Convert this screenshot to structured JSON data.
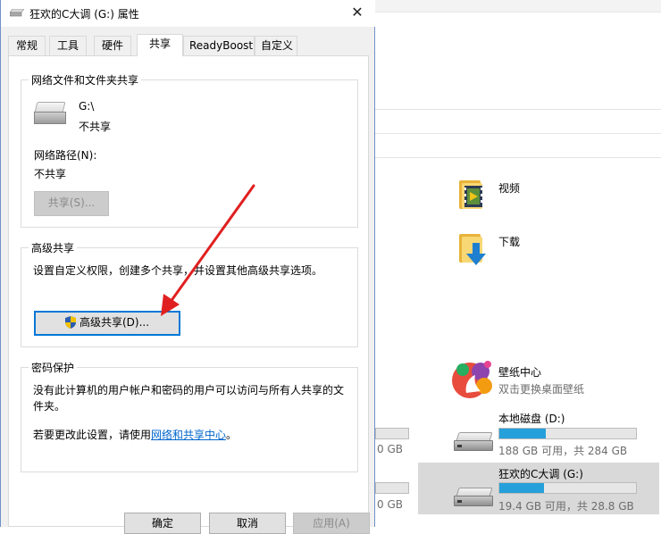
{
  "dialog": {
    "title": "狂欢的C大调 (G:) 属性",
    "close_icon": "close-icon",
    "tabs": [
      {
        "label": "常规"
      },
      {
        "label": "工具"
      },
      {
        "label": "硬件"
      },
      {
        "label": "共享",
        "active": true
      },
      {
        "label": "ReadyBoost"
      },
      {
        "label": "自定义"
      }
    ],
    "network_sharing": {
      "group_title": "网络文件和文件夹共享",
      "drive_name": "G:\\",
      "drive_status": "不共享",
      "network_path_label": "网络路径(N):",
      "network_path_value": "不共享",
      "share_button": "共享(S)..."
    },
    "advanced_sharing": {
      "group_title": "高级共享",
      "description": "设置自定义权限，创建多个共享，并设置其他高级共享选项。",
      "button": "高级共享(D)..."
    },
    "password_protection": {
      "group_title": "密码保护",
      "text_line1": "没有此计算机的用户帐户和密码的用户可以访问与所有人共享的文",
      "text_line2": "件夹。",
      "change_prefix": "若要更改此设置，请使用",
      "link": "网络和共享中心",
      "change_suffix": "。"
    },
    "buttons": {
      "ok": "确定",
      "cancel": "取消",
      "apply": "应用(A)"
    }
  },
  "explorer": {
    "folders": [
      {
        "label": "视频",
        "icon": "video-folder-icon"
      },
      {
        "label": "下载",
        "icon": "download-folder-icon"
      }
    ],
    "app": {
      "title": "壁纸中心",
      "subtitle": "双击更换桌面壁纸"
    },
    "partial_sizes": [
      "0 GB",
      "0 GB"
    ],
    "drives": [
      {
        "label": "本地磁盘 (D:)",
        "size_text": "188 GB 可用，共 284 GB",
        "used_fraction": 0.34
      },
      {
        "label": "狂欢的C大调 (G:)",
        "size_text": "19.4 GB 可用，共 28.8 GB",
        "used_fraction": 0.33,
        "selected": true
      }
    ]
  },
  "colors": {
    "accent": "#0078d7",
    "arrow": "#e02020",
    "bar_fill": "#26a0da",
    "link": "#0066cc"
  }
}
